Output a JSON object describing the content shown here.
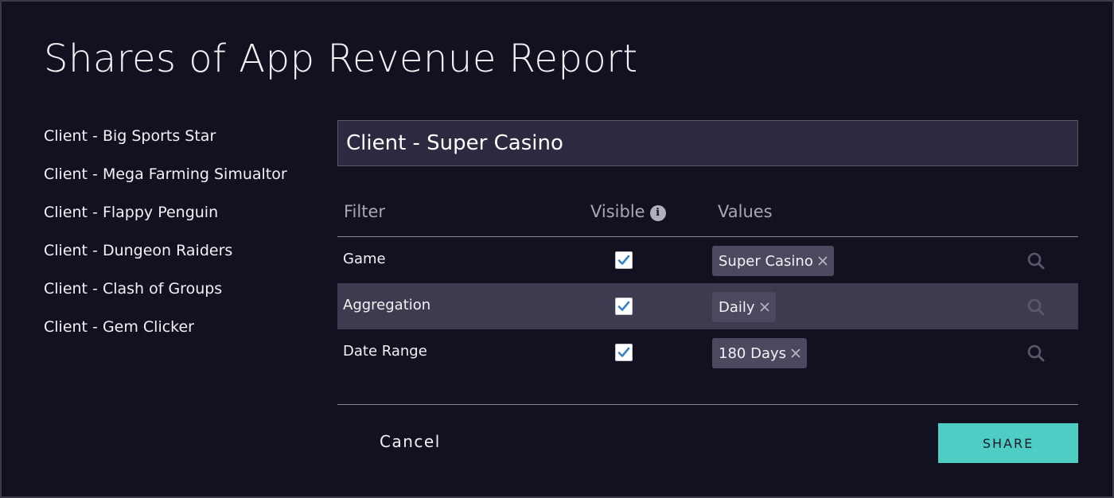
{
  "title": "Shares of App Revenue Report",
  "clients": [
    "Client - Big Sports Star",
    "Client - Mega Farming Simualtor",
    "Client - Flappy Penguin",
    "Client - Dungeon Raiders",
    "Client - Clash of Groups",
    "Client - Gem Clicker"
  ],
  "selected_client": "Client - Super Casino",
  "table": {
    "headers": {
      "filter": "Filter",
      "visible": "Visible",
      "values": "Values"
    },
    "rows": [
      {
        "filter": "Game",
        "visible": true,
        "value": "Super Casino",
        "highlighted": false
      },
      {
        "filter": "Aggregation",
        "visible": true,
        "value": "Daily",
        "highlighted": true
      },
      {
        "filter": "Date Range",
        "visible": true,
        "value": "180 Days",
        "highlighted": false
      }
    ]
  },
  "actions": {
    "cancel": "Cancel",
    "share": "SHARE"
  },
  "colors": {
    "background": "#12111f",
    "accent": "#4ecdc4",
    "checkbox_check": "#3b82c4",
    "highlight_row": "#3d3b50"
  },
  "icons": {
    "info": "info-icon",
    "check": "checkmark-icon",
    "remove": "close-icon",
    "search": "search-icon"
  }
}
